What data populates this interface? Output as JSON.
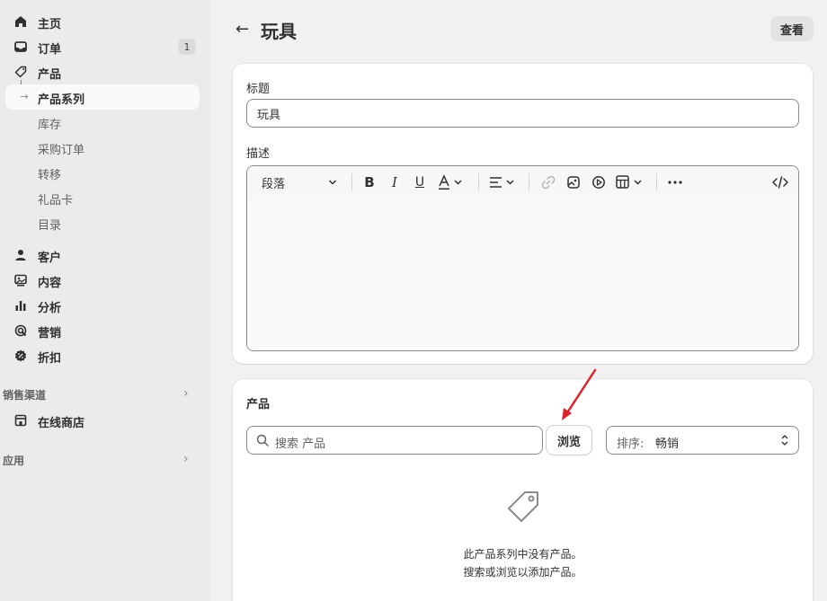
{
  "sidebar": {
    "items": [
      {
        "label": "主页",
        "icon": "home-icon"
      },
      {
        "label": "订单",
        "icon": "inbox-icon",
        "badge": "1"
      },
      {
        "label": "产品",
        "icon": "tag-icon"
      },
      {
        "label": "产品系列",
        "active": true
      },
      {
        "label": "库存"
      },
      {
        "label": "采购订单"
      },
      {
        "label": "转移"
      },
      {
        "label": "礼品卡"
      },
      {
        "label": "目录"
      },
      {
        "label": "客户",
        "icon": "person-icon"
      },
      {
        "label": "内容",
        "icon": "content-icon"
      },
      {
        "label": "分析",
        "icon": "bar-chart-icon"
      },
      {
        "label": "营销",
        "icon": "target-icon"
      },
      {
        "label": "折扣",
        "icon": "discount-icon"
      },
      {
        "label": "在线商店",
        "icon": "store-icon"
      }
    ],
    "sales_channels_title": "销售渠道",
    "apps_title": "应用"
  },
  "header": {
    "back_glyph": "←",
    "title": "玩具",
    "view_label": "查看"
  },
  "details": {
    "title_label": "标题",
    "title_value": "玩具",
    "description_label": "描述",
    "format_select": "段落"
  },
  "products": {
    "heading": "产品",
    "search_placeholder": "搜索 产品",
    "browse_label": "浏览",
    "sort_label": "排序:",
    "sort_value": "畅销",
    "empty_line1": "此产品系列中没有产品。",
    "empty_line2": "搜索或浏览以添加产品。"
  },
  "colors": {
    "annotation_arrow": "#d9262e",
    "sidebar_bg": "#ebebeb",
    "page_bg": "#f1f1f1"
  }
}
